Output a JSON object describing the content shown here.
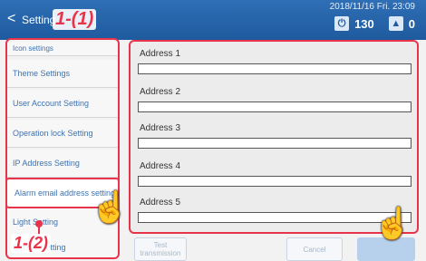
{
  "header": {
    "back_glyph": "<",
    "title": "Setting",
    "datetime": "2018/11/16 Fri. 23:09",
    "power_count": "130",
    "warning_count": "0"
  },
  "sidebar": {
    "items": [
      {
        "label": "Icon settings"
      },
      {
        "label": "Theme Settings"
      },
      {
        "label": "User Account Setting"
      },
      {
        "label": "Operation lock Setting"
      },
      {
        "label": "IP Address Setting"
      },
      {
        "label": "Alarm email address setting"
      },
      {
        "label": "Light Setting"
      },
      {
        "label": "DipSW Setting"
      }
    ]
  },
  "panel": {
    "addresses": [
      {
        "label": "Address 1",
        "value": ""
      },
      {
        "label": "Address 2",
        "value": ""
      },
      {
        "label": "Address 3",
        "value": ""
      },
      {
        "label": "Address 4",
        "value": ""
      },
      {
        "label": "Address 5",
        "value": ""
      }
    ]
  },
  "buttons": {
    "test": "Test transmission",
    "cancel": "Cancel",
    "ok": ""
  },
  "annotations": {
    "step1": "1-(1)",
    "step2": "1-(2)"
  }
}
